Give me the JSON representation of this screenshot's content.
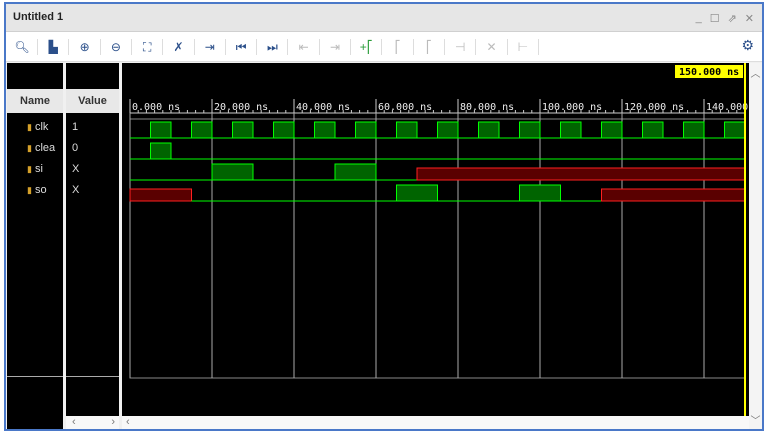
{
  "window": {
    "title": "Untitled 1",
    "controls": [
      "_",
      "☐",
      "⇗",
      "✕"
    ]
  },
  "toolbar": [
    {
      "name": "search-icon",
      "glyph": "🔍︎",
      "state": "on"
    },
    {
      "name": "save-icon",
      "glyph": "▙",
      "state": "on"
    },
    {
      "name": "zoom-in-icon",
      "glyph": "⊕",
      "state": "on"
    },
    {
      "name": "zoom-out-icon",
      "glyph": "⊖",
      "state": "on"
    },
    {
      "name": "zoom-fit-icon",
      "glyph": "⛶",
      "state": "on"
    },
    {
      "name": "cursor-to-zero-icon",
      "glyph": "✗",
      "state": "on"
    },
    {
      "name": "go-to-time-icon",
      "glyph": "⇥",
      "state": "on"
    },
    {
      "name": "go-to-start-icon",
      "glyph": "⏮",
      "state": "on"
    },
    {
      "name": "go-to-end-icon",
      "glyph": "⏭",
      "state": "on"
    },
    {
      "name": "prev-transition-icon",
      "glyph": "⇤",
      "state": "dis"
    },
    {
      "name": "next-transition-icon",
      "glyph": "⇥",
      "state": "dis"
    },
    {
      "name": "add-marker-icon",
      "glyph": "+⎡",
      "state": "green"
    },
    {
      "name": "prev-marker-icon",
      "glyph": "⎡",
      "state": "dis"
    },
    {
      "name": "next-marker-icon",
      "glyph": "⎡",
      "state": "dis"
    },
    {
      "name": "swap-cursors-icon",
      "glyph": "⊣",
      "state": "dis"
    },
    {
      "name": "delete-marker-icon",
      "glyph": "✕",
      "state": "dis"
    },
    {
      "name": "snap-icon",
      "glyph": "⊢",
      "state": "dis"
    }
  ],
  "headers": {
    "name": "Name",
    "value": "Value"
  },
  "cursor_label": "150.000 ns",
  "time_labels": [
    "0.000 ns",
    "20.000 ns",
    "40.000 ns",
    "60.000 ns",
    "80.000 ns",
    "100.000 ns",
    "120.000 ns",
    "140.000"
  ],
  "time_range": [
    0,
    150
  ],
  "signals": [
    {
      "name": "clk",
      "value": "1",
      "segments": [
        [
          0,
          5,
          "0"
        ],
        [
          5,
          10,
          "1"
        ],
        [
          10,
          15,
          "0"
        ],
        [
          15,
          20,
          "1"
        ],
        [
          20,
          25,
          "0"
        ],
        [
          25,
          30,
          "1"
        ],
        [
          30,
          35,
          "0"
        ],
        [
          35,
          40,
          "1"
        ],
        [
          40,
          45,
          "0"
        ],
        [
          45,
          50,
          "1"
        ],
        [
          50,
          55,
          "0"
        ],
        [
          55,
          60,
          "1"
        ],
        [
          60,
          65,
          "0"
        ],
        [
          65,
          70,
          "1"
        ],
        [
          70,
          75,
          "0"
        ],
        [
          75,
          80,
          "1"
        ],
        [
          80,
          85,
          "0"
        ],
        [
          85,
          90,
          "1"
        ],
        [
          90,
          95,
          "0"
        ],
        [
          95,
          100,
          "1"
        ],
        [
          100,
          105,
          "0"
        ],
        [
          105,
          110,
          "1"
        ],
        [
          110,
          115,
          "0"
        ],
        [
          115,
          120,
          "1"
        ],
        [
          120,
          125,
          "0"
        ],
        [
          125,
          130,
          "1"
        ],
        [
          130,
          135,
          "0"
        ],
        [
          135,
          140,
          "1"
        ],
        [
          140,
          145,
          "0"
        ],
        [
          145,
          150,
          "1"
        ]
      ]
    },
    {
      "name": "clea",
      "value": "0",
      "segments": [
        [
          0,
          5,
          "0"
        ],
        [
          5,
          10,
          "1"
        ],
        [
          10,
          150,
          "0"
        ]
      ]
    },
    {
      "name": "si",
      "value": "X",
      "segments": [
        [
          0,
          20,
          "0"
        ],
        [
          20,
          30,
          "1"
        ],
        [
          30,
          50,
          "0"
        ],
        [
          50,
          60,
          "1"
        ],
        [
          60,
          70,
          "0"
        ],
        [
          70,
          150,
          "X"
        ]
      ]
    },
    {
      "name": "so",
      "value": "X",
      "segments": [
        [
          0,
          15,
          "X"
        ],
        [
          15,
          65,
          "0"
        ],
        [
          65,
          75,
          "1"
        ],
        [
          75,
          95,
          "0"
        ],
        [
          95,
          105,
          "1"
        ],
        [
          105,
          115,
          "0"
        ],
        [
          115,
          150,
          "X"
        ]
      ]
    }
  ],
  "colors": {
    "high": "#00ff00",
    "fill": "#006400",
    "x": "#ff2020",
    "xfill": "#5a0000",
    "cursor": "#ffff00"
  }
}
